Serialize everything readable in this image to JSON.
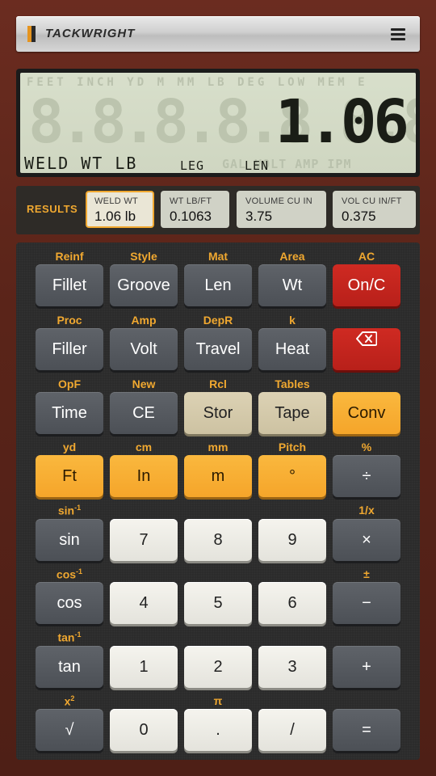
{
  "brand": {
    "name": "TACKWRIGHT"
  },
  "display": {
    "ghost_top": "FEET INCH YD M MM LB DEG LOW MEM E",
    "ghost_digits": "8.8.8.8.8.8.8.8.8.",
    "value": "1.06",
    "mode_label": "WELD WT LB",
    "leg_label": "LEG",
    "len_label": "LEN",
    "ghost_bottom": "GAL VOLT AMP IPM"
  },
  "results": {
    "label": "RESULTS",
    "cards": [
      {
        "key": "WELD WT",
        "value": "1.06 lb"
      },
      {
        "key": "WT LB/FT",
        "value": "0.1063"
      },
      {
        "key": "VOLUME CU IN",
        "value": "3.75"
      },
      {
        "key": "VOL CU IN/FT",
        "value": "0.375"
      }
    ]
  },
  "keys": {
    "row1": [
      {
        "sec": "Reinf",
        "label": "Fillet"
      },
      {
        "sec": "Style",
        "label": "Groove"
      },
      {
        "sec": "Mat",
        "label": "Len"
      },
      {
        "sec": "Area",
        "label": "Wt"
      },
      {
        "sec": "AC",
        "label": "On/C"
      }
    ],
    "row2": [
      {
        "sec": "Proc",
        "label": "Filler"
      },
      {
        "sec": "Amp",
        "label": "Volt"
      },
      {
        "sec": "DepR",
        "label": "Travel"
      },
      {
        "sec": "k",
        "label": "Heat"
      },
      {
        "sec": "",
        "label": "backspace-icon"
      }
    ],
    "row3": [
      {
        "sec": "OpF",
        "label": "Time"
      },
      {
        "sec": "New",
        "label": "CE"
      },
      {
        "sec": "Rcl",
        "label": "Stor"
      },
      {
        "sec": "Tables",
        "label": "Tape"
      },
      {
        "sec": "",
        "label": "Conv"
      }
    ],
    "row4": [
      {
        "sec": "yd",
        "label": "Ft"
      },
      {
        "sec": "cm",
        "label": "In"
      },
      {
        "sec": "mm",
        "label": "m"
      },
      {
        "sec": "Pitch",
        "label": "°"
      },
      {
        "sec": "%",
        "label": "÷"
      }
    ],
    "row5": [
      {
        "sec": "sin",
        "sec_sup": "-1",
        "label": "sin"
      },
      {
        "sec": "",
        "label": "7"
      },
      {
        "sec": "",
        "label": "8"
      },
      {
        "sec": "",
        "label": "9"
      },
      {
        "sec": "1/x",
        "label": "×"
      }
    ],
    "row6": [
      {
        "sec": "cos",
        "sec_sup": "-1",
        "label": "cos"
      },
      {
        "sec": "",
        "label": "4"
      },
      {
        "sec": "",
        "label": "5"
      },
      {
        "sec": "",
        "label": "6"
      },
      {
        "sec": "±",
        "label": "−"
      }
    ],
    "row7": [
      {
        "sec": "tan",
        "sec_sup": "-1",
        "label": "tan"
      },
      {
        "sec": "",
        "label": "1"
      },
      {
        "sec": "",
        "label": "2"
      },
      {
        "sec": "",
        "label": "3"
      },
      {
        "sec": "",
        "label": "+"
      }
    ],
    "row8": [
      {
        "sec": "x",
        "sec_sup": "2",
        "label": "√"
      },
      {
        "sec": "",
        "label": "0"
      },
      {
        "sec": "π",
        "label": "."
      },
      {
        "sec": "",
        "label": "/"
      },
      {
        "sec": "",
        "label": "="
      }
    ]
  },
  "colors": {
    "frame": "#5a2419",
    "accent_orange": "#f5a52a",
    "clear_red": "#b8201a",
    "lcd_bg": "#cfd6c1"
  }
}
